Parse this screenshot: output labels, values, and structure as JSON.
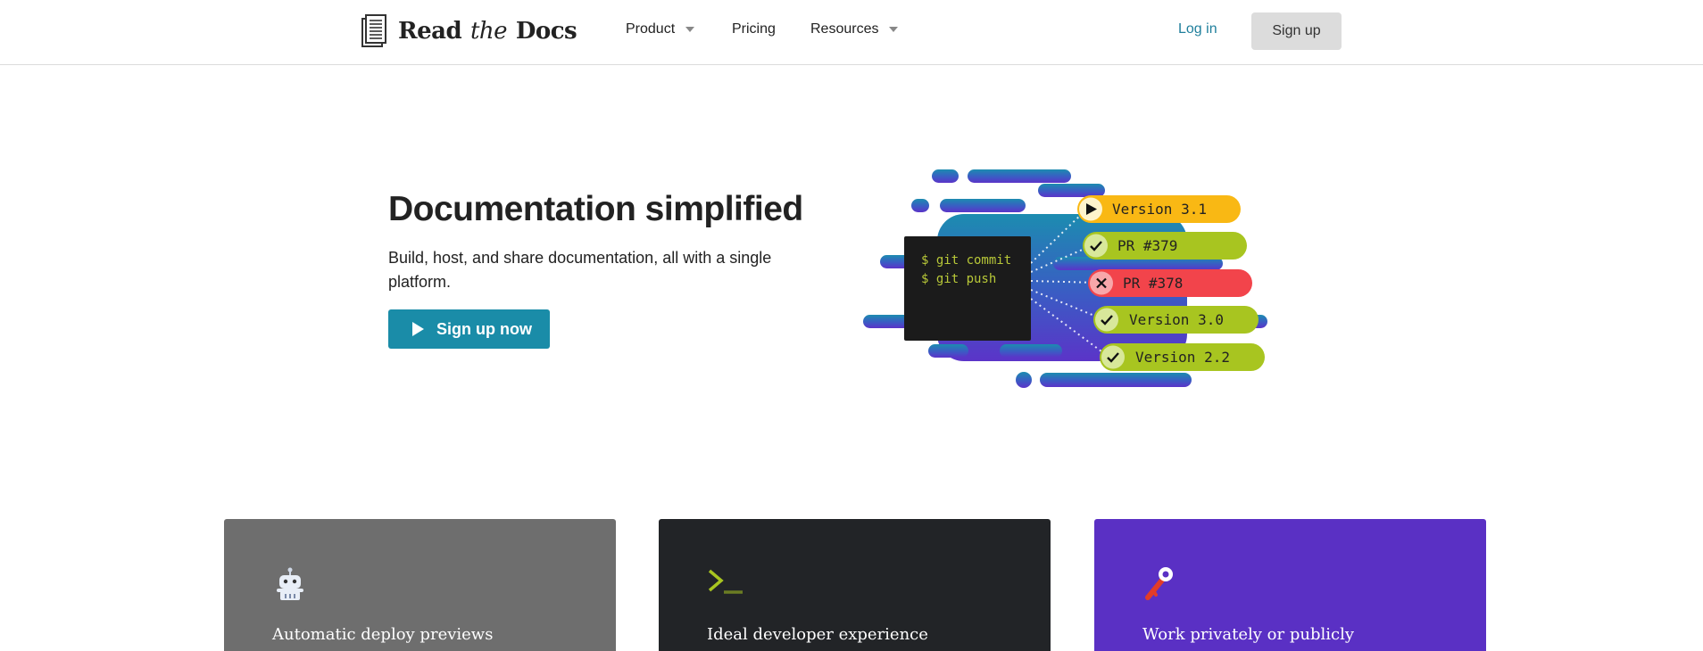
{
  "nav": {
    "logo": {
      "read": "Read",
      "the": "the",
      "docs": "Docs"
    },
    "items": [
      {
        "label": "Product",
        "has_dropdown": true
      },
      {
        "label": "Pricing",
        "has_dropdown": false
      },
      {
        "label": "Resources",
        "has_dropdown": true
      }
    ],
    "login_label": "Log in",
    "signup_label": "Sign up"
  },
  "hero": {
    "title": "Documentation simplified",
    "subtitle": "Build, host, and share documentation, all with a single platform.",
    "cta_label": "Sign up now"
  },
  "illustration": {
    "terminal_lines": [
      "$ git commit",
      "$ git push"
    ],
    "builds": [
      {
        "label": "Version 3.1",
        "status": "running",
        "color": "#f9b814"
      },
      {
        "label": "PR #379",
        "status": "passed",
        "color": "#a8c520"
      },
      {
        "label": "PR #378",
        "status": "failed",
        "color": "#f2444b"
      },
      {
        "label": "Version 3.0",
        "status": "passed",
        "color": "#a8c520"
      },
      {
        "label": "Version 2.2",
        "status": "passed",
        "color": "#a8c520"
      }
    ]
  },
  "features": [
    {
      "title": "Automatic deploy previews",
      "icon": "robot-icon",
      "color": "#6e6e6e"
    },
    {
      "title": "Ideal developer experience",
      "icon": "terminal-prompt-icon",
      "color": "#222427"
    },
    {
      "title": "Work privately or publicly",
      "icon": "key-icon",
      "color": "#5a30c4"
    }
  ],
  "colors": {
    "accent": "#1a8ca8",
    "link": "#1f7f9c"
  }
}
